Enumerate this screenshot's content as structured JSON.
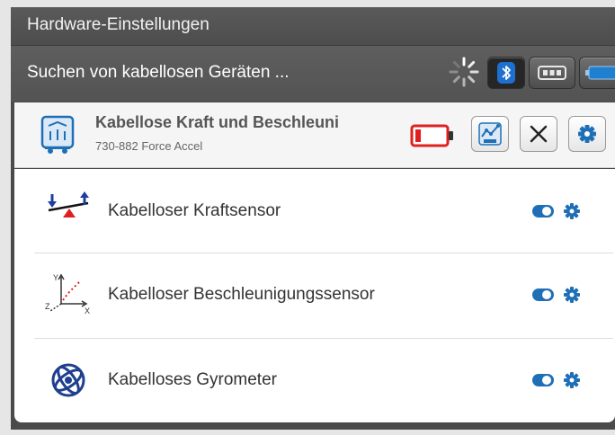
{
  "window": {
    "title": "Hardware-Einstellungen"
  },
  "scan": {
    "status_text": "Suchen von kabellosen Geräten ..."
  },
  "toolbar": {
    "buttons": [
      {
        "name": "bluetooth",
        "icon": "bluetooth-icon",
        "active": true
      },
      {
        "name": "wired-connection",
        "icon": "usb-connector-icon",
        "active": false
      },
      {
        "name": "battery-connection",
        "icon": "battery-icon",
        "active": false
      }
    ]
  },
  "device": {
    "name": "Kabellose Kraft und Beschleuni",
    "model": "730-882 Force Accel",
    "icon": "wireless-sensor-icon",
    "battery_state": "low",
    "battery_color": "#e02020",
    "buttons": [
      "analyze-icon",
      "close-icon",
      "gear-icon"
    ]
  },
  "sensors": [
    {
      "label": "Kabelloser Kraftsensor",
      "icon": "force-sensor-icon",
      "enabled": true
    },
    {
      "label": "Kabelloser Beschleunigungssensor",
      "icon": "accelerometer-axes-icon",
      "enabled": true
    },
    {
      "label": "Kabelloses Gyrometer",
      "icon": "gyroscope-icon",
      "enabled": true
    }
  ],
  "colors": {
    "accent": "#1f6fb7",
    "toggle": "#1f6fb7"
  }
}
